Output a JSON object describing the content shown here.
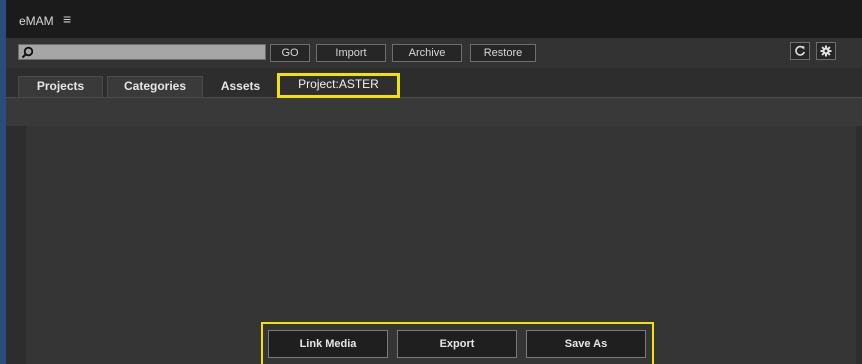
{
  "app": {
    "title": "eMAM",
    "menu_glyph": "≡"
  },
  "toolbar": {
    "search": {
      "value": "",
      "placeholder": ""
    },
    "buttons": {
      "go": "GO",
      "import": "Import",
      "archive": "Archive",
      "restore": "Restore"
    },
    "icons": {
      "refresh": "refresh-icon",
      "settings": "gear-icon",
      "search": "search-icon"
    }
  },
  "tabs": {
    "projects": "Projects",
    "categories": "Categories",
    "assets": "Assets",
    "project_aster": "Project:ASTER",
    "active": "Project:ASTER"
  },
  "actions": {
    "link_media": "Link Media",
    "export": "Export",
    "save_as": "Save As"
  },
  "colors": {
    "highlight": "#f2e20a",
    "accent_edge": "#2a4e7c",
    "background": "#2d2d2d"
  }
}
